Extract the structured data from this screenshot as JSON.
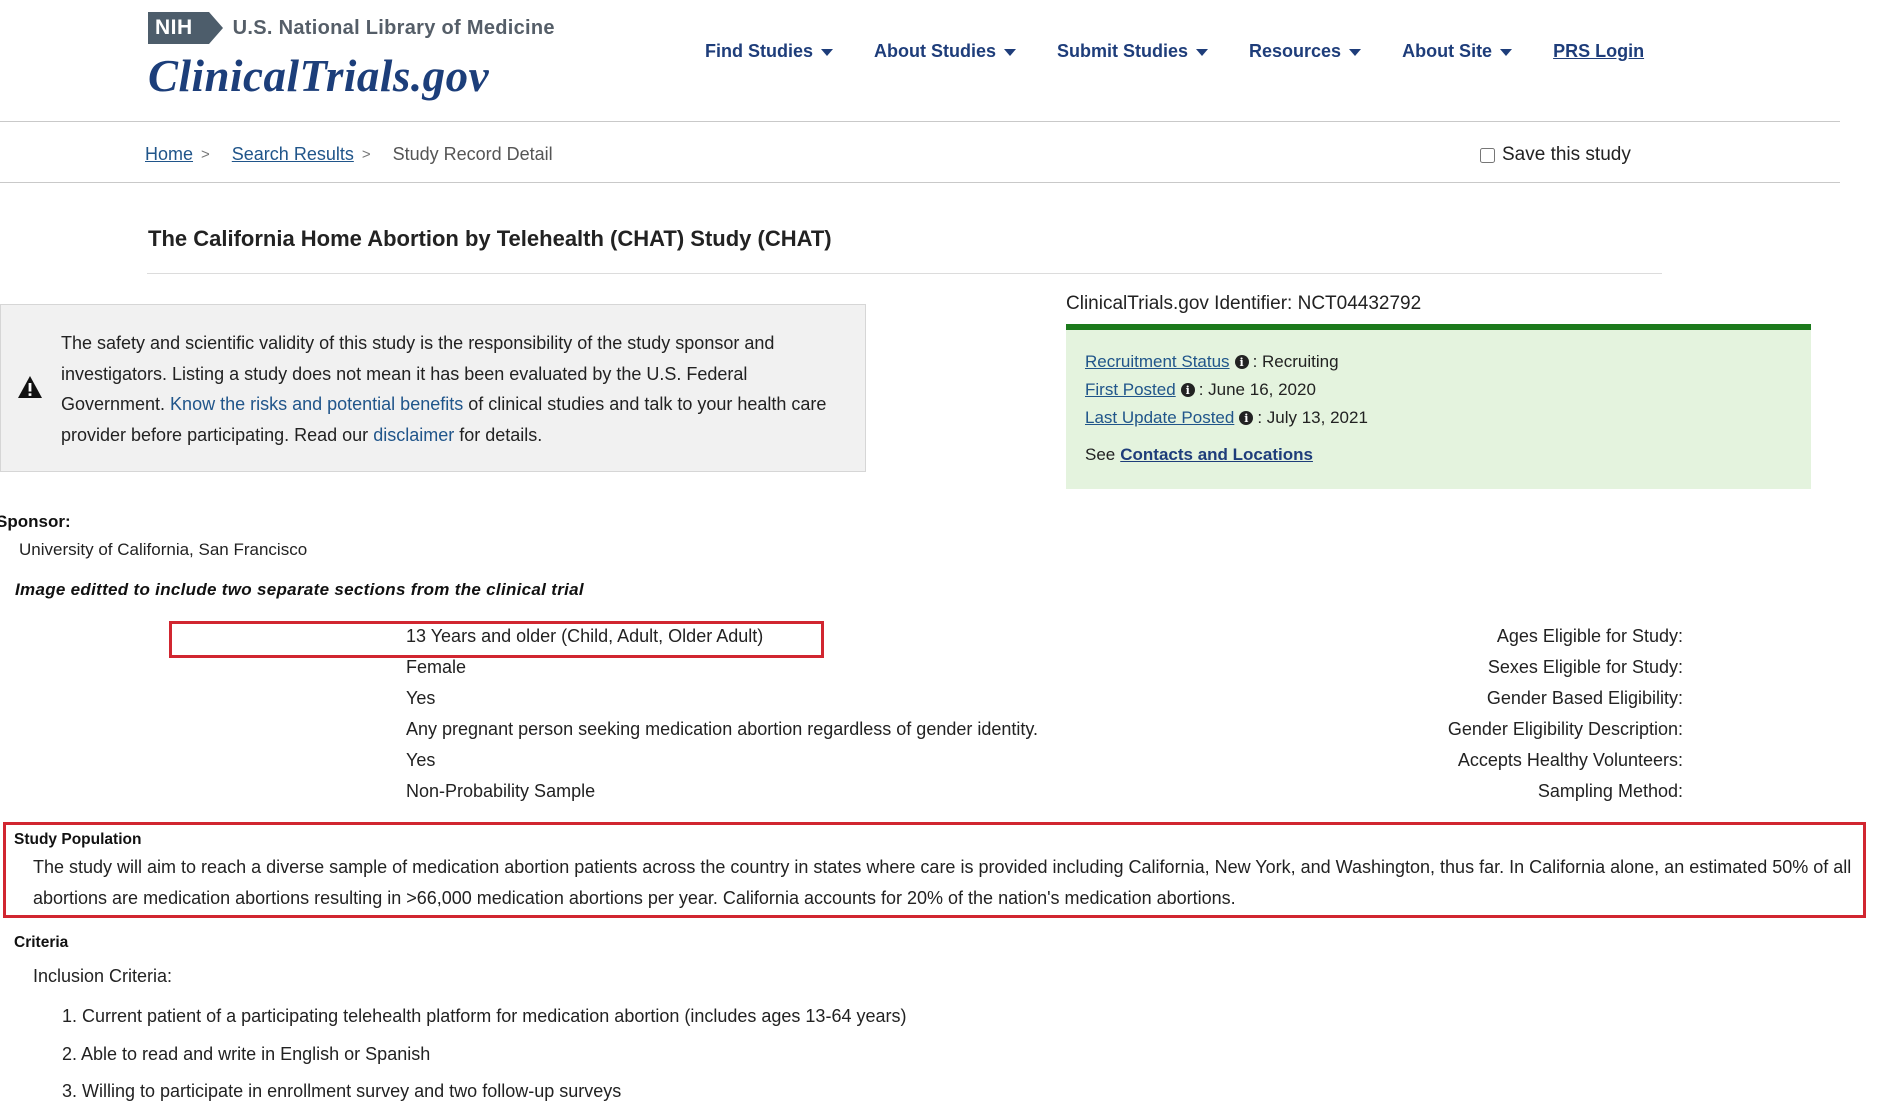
{
  "header": {
    "nih_badge": "NIH",
    "nlm_text": "U.S. National Library of Medicine",
    "site_logo": "ClinicalTrials.gov",
    "nav": [
      {
        "label": "Find Studies",
        "has_caret": true
      },
      {
        "label": "About Studies",
        "has_caret": true
      },
      {
        "label": "Submit Studies",
        "has_caret": true
      },
      {
        "label": "Resources",
        "has_caret": true
      },
      {
        "label": "About Site",
        "has_caret": true
      }
    ],
    "login_link": "PRS Login",
    "caret_icon": "caret-down-icon"
  },
  "breadcrumb": {
    "home": "Home",
    "search_results": "Search Results",
    "current": "Study Record Detail",
    "separator": ">"
  },
  "save_study_label": "Save this study",
  "study_title": "The California Home Abortion by Telehealth (CHAT) Study (CHAT)",
  "disclaimer": {
    "icon": "warning-triangle-icon",
    "text_1": "The safety and scientific validity of this study is the responsibility of the study sponsor and investigators. Listing a study does not mean it has been evaluated by the U.S. Federal Government. ",
    "link_risks": "Know the risks and potential benefits",
    "text_2": " of clinical studies and talk to your health care provider before participating. Read our ",
    "link_disclaimer": "disclaimer",
    "text_3": " for details."
  },
  "identifier": "ClinicalTrials.gov Identifier: NCT04432792",
  "status_box": {
    "recruitment_label": "Recruitment Status",
    "recruitment_value": ": Recruiting",
    "first_posted_label": "First Posted",
    "first_posted_value": ": June 16, 2020",
    "last_update_label": "Last Update Posted",
    "last_update_value": ": July 13, 2021",
    "see_prefix": "See",
    "contacts_link": "Contacts and Locations",
    "info_icon": "info-circle-icon",
    "accent_color": "#1c7a1c",
    "background_color": "#e4f3de"
  },
  "sponsor": {
    "heading": "Sponsor:",
    "value": "University of California, San Francisco"
  },
  "edit_note": "Image editted to include two separate sections from the clinical trial",
  "eligibility": [
    {
      "label": "Ages Eligible for Study:",
      "value": "13 Years and older   (Child, Adult, Older Adult)"
    },
    {
      "label": "Sexes Eligible for Study:",
      "value": "Female"
    },
    {
      "label": "Gender Based Eligibility:",
      "value": "Yes"
    },
    {
      "label": "Gender Eligibility Description:",
      "value": "Any pregnant person seeking medication abortion regardless of gender identity."
    },
    {
      "label": "Accepts Healthy Volunteers:",
      "value": "Yes"
    },
    {
      "label": "Sampling Method:",
      "value": "Non-Probability Sample"
    }
  ],
  "highlight_color": "#d12630",
  "study_population": {
    "heading": "Study Population",
    "text": "The study will aim to reach a diverse sample of medication abortion patients across the country in states where care is provided including California, New York, and Washington, thus far. In California alone, an estimated 50% of all abortions are medication abortions resulting in >66,000 medication abortions per year. California accounts for 20% of the nation's medication abortions."
  },
  "criteria": {
    "heading": "Criteria",
    "inclusion_heading": "Inclusion Criteria:",
    "items": [
      "1. Current patient of a participating telehealth platform for medication abortion (includes ages 13-64 years)",
      "2. Able to read and write in English or Spanish",
      "3. Willing to participate in enrollment survey and two follow-up surveys"
    ]
  }
}
